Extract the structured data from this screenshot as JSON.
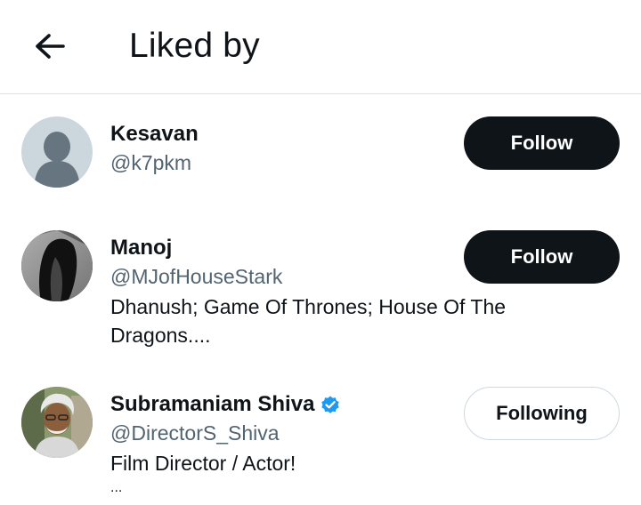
{
  "header": {
    "title": "Liked by"
  },
  "users": [
    {
      "name": "Kesavan",
      "handle": "@k7pkm",
      "bio": [],
      "button": "Follow",
      "verified": false
    },
    {
      "name": "Manoj",
      "handle": "@MJofHouseStark",
      "bio": [
        "Dhanush; Game Of Thrones; House Of The",
        "Dragons...."
      ],
      "button": "Follow",
      "verified": false
    },
    {
      "name": "Subramaniam Shiva",
      "handle": "@DirectorS_Shiva",
      "bio": [
        "Film Director / Actor!",
        "..."
      ],
      "button": "Following",
      "verified": true
    }
  ],
  "colors": {
    "primary_text": "#0f1419",
    "secondary_text": "#536471",
    "verified": "#1d9bf0",
    "divider": "#dfe3e6"
  }
}
